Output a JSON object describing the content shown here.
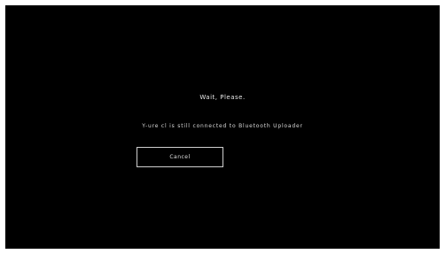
{
  "dialog": {
    "title": "Wait, Please.",
    "message": "Y-ure cl is still connected to Bluetooth Uploader",
    "button_label": "Cancel"
  },
  "colors": {
    "background": "#000000",
    "text": "#e8e8e8",
    "button_border": "#cfcfcf"
  }
}
